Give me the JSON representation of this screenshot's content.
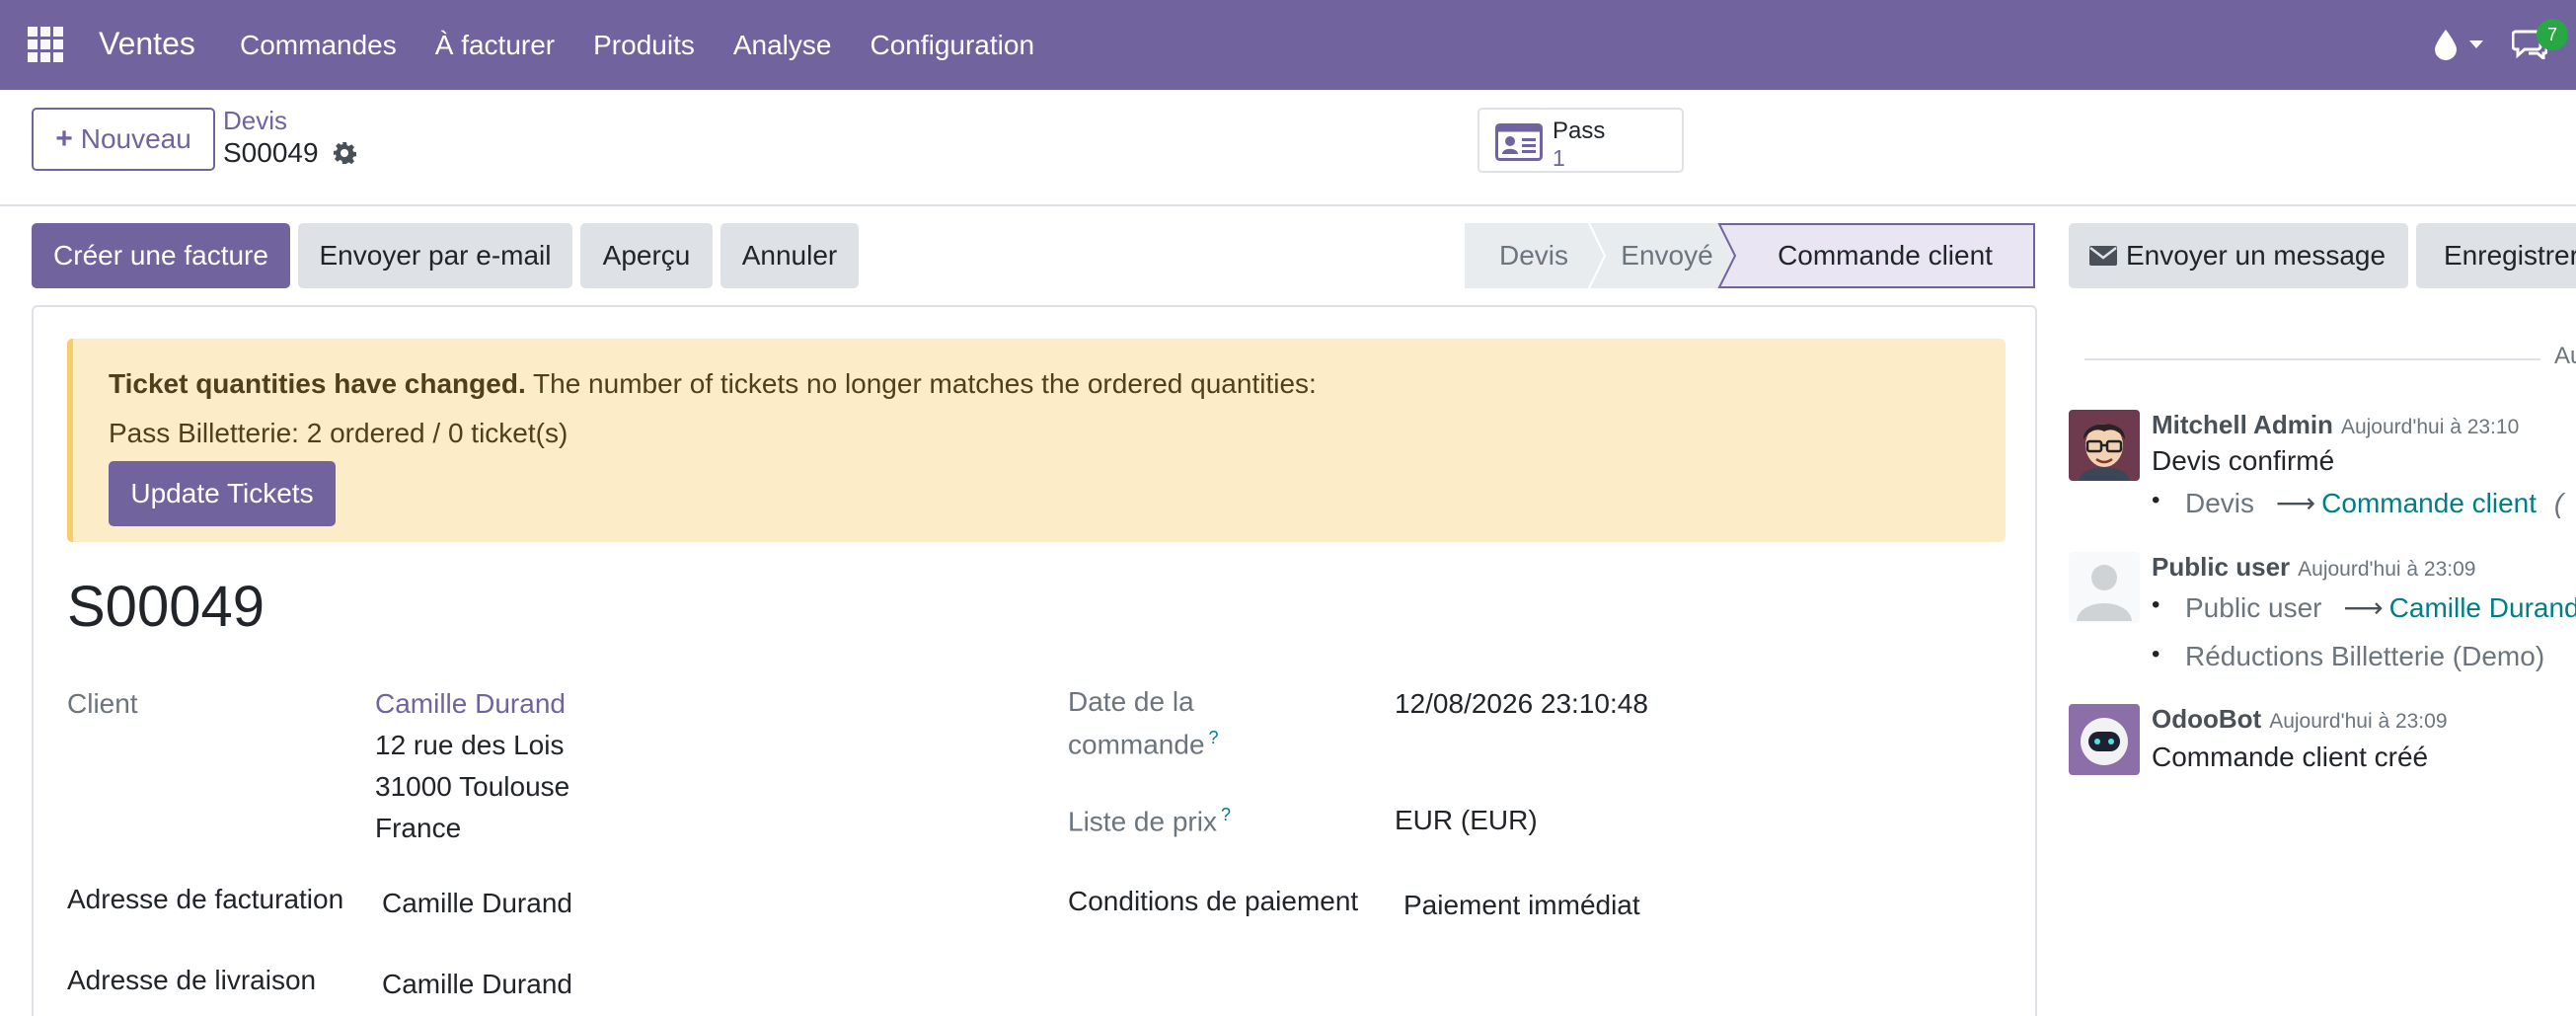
{
  "navbar": {
    "app_name": "Ventes",
    "menu": [
      "Commandes",
      "À facturer",
      "Produits",
      "Analyse",
      "Configuration"
    ],
    "messages_badge": "7",
    "color": "#71639e"
  },
  "control_panel": {
    "new_label": "Nouveau",
    "breadcrumb_parent": "Devis",
    "breadcrumb_current": "S00049",
    "smart_button": {
      "title": "Pass",
      "count": "1",
      "icon": "id-card-icon"
    }
  },
  "actions": {
    "create_invoice": "Créer une facture",
    "send_email": "Envoyer par e-mail",
    "preview": "Aperçu",
    "cancel": "Annuler"
  },
  "status": {
    "steps": [
      "Devis",
      "Envoyé",
      "Commande client"
    ],
    "current": "Commande client"
  },
  "alert": {
    "title": "Ticket quantities have changed.",
    "message": "The number of tickets no longer matches the ordered quantities:",
    "detail": "Pass Billetterie: 2 ordered / 0 ticket(s)",
    "button": "Update Tickets"
  },
  "form": {
    "name": "S00049",
    "client_label": "Client",
    "client_name": "Camille Durand",
    "address": [
      "12 rue des Lois",
      "31000 Toulouse",
      "France"
    ],
    "order_date_label_1": "Date de la",
    "order_date_label_2": "commande",
    "order_date": "12/08/2026 23:10:48",
    "pricelist_label": "Liste de prix",
    "pricelist": "EUR (EUR)",
    "invoice_address_label": "Adresse de facturation",
    "invoice_address": "Camille Durand",
    "payment_terms_label": "Conditions de paiement",
    "payment_terms": "Paiement immédiat",
    "delivery_address_label": "Adresse de livraison",
    "delivery_address": "Camille Durand",
    "help_mark": "?"
  },
  "chatter": {
    "send_message": "Envoyer un message",
    "log_note": "Enregistrer une note",
    "date_separator": "Aujourd'hui",
    "messages": [
      {
        "author": "Mitchell Admin",
        "date": "Aujourd'hui à 23:10",
        "body": "Devis confirmé",
        "tracking": {
          "old": "Devis",
          "new": "Commande client",
          "suffix": "("
        }
      },
      {
        "author": "Public user",
        "date": "Aujourd'hui à 23:09",
        "tracking": [
          {
            "old": "Public user",
            "new": "Camille Durand"
          },
          {
            "old": "Réductions Billetterie (Demo)"
          }
        ]
      },
      {
        "author": "OdooBot",
        "date": "Aujourd'hui à 23:09",
        "body": "Commande client créé"
      }
    ]
  }
}
